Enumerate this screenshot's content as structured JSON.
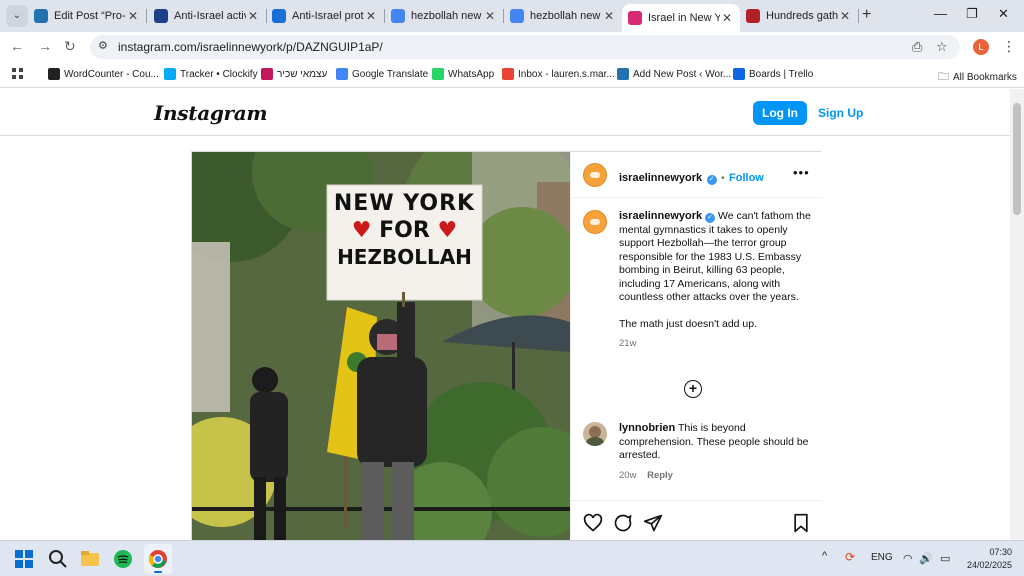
{
  "browser": {
    "tabs": [
      {
        "title": "Edit Post “Pro-H",
        "favicon": "wordpress-icon",
        "color": "#2271b1",
        "active": false
      },
      {
        "title": "Anti-Israel activ",
        "favicon": "news-icon",
        "color": "#1d3f8a",
        "active": false
      },
      {
        "title": "Anti-Israel prote",
        "favicon": "seven-icon",
        "color": "#1a6fd6",
        "active": false
      },
      {
        "title": "hezbollah new y",
        "favicon": "google-icon",
        "color": "#4285f4",
        "active": false
      },
      {
        "title": "hezbollah new y",
        "favicon": "google-icon",
        "color": "#4285f4",
        "active": false
      },
      {
        "title": "Israel in New Yo",
        "favicon": "instagram-icon",
        "color": "#d62976",
        "active": true
      },
      {
        "title": "Hundreds gathe",
        "favicon": "news-icon",
        "color": "#b3202a",
        "active": false
      }
    ],
    "url": "instagram.com/israelinnewyork/p/DAZNGUIP1aP/",
    "profile_initial": "L",
    "bookmarks": [
      {
        "label": "WordCounter - Cou...",
        "icon": "w-icon",
        "color": "#222"
      },
      {
        "label": "Tracker • Clockify",
        "icon": "clockify-icon",
        "color": "#03a9f4"
      },
      {
        "label": "עצמאי שכיר",
        "icon": "y-icon",
        "color": "#c2185b"
      },
      {
        "label": "Google Translate",
        "icon": "translate-icon",
        "color": "#4285f4"
      },
      {
        "label": "WhatsApp",
        "icon": "whatsapp-icon",
        "color": "#25d366"
      },
      {
        "label": "Inbox - lauren.s.mar...",
        "icon": "gmail-icon",
        "color": "#ea4335"
      },
      {
        "label": "Add New Post ‹ Wor...",
        "icon": "wordpress-icon",
        "color": "#2271b1"
      },
      {
        "label": "Boards | Trello",
        "icon": "trello-icon",
        "color": "#0c66e4"
      }
    ],
    "all_bookmarks": "All Bookmarks"
  },
  "instagram": {
    "logo": "Instagram",
    "login": "Log In",
    "signup": "Sign Up",
    "post": {
      "username": "israelinnewyork",
      "follow": "Follow",
      "dot": "•",
      "caption": "We can't fathom the mental gymnastics it takes to openly support Hezbollah—the terror group responsible for the 1983 U.S. Embassy bombing in Beirut, killing 63 people, including 17 Americans, along with countless other attacks over the years.",
      "caption2": "The math just doesn't add up.",
      "age": "21w",
      "sign": {
        "line1": "NEW YORK",
        "line2": "FOR",
        "line3": "HEZBOLLAH"
      },
      "comment": {
        "username": "lynnobrien",
        "text": "This is beyond comprehension. These people should be arrested.",
        "age": "20w",
        "reply": "Reply"
      }
    }
  },
  "taskbar": {
    "lang": "ENG",
    "time": "07:30",
    "date": "24/02/2025"
  }
}
